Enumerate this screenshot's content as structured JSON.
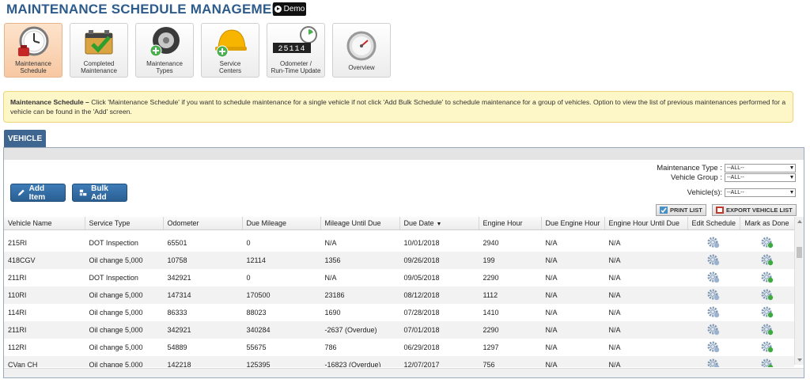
{
  "header": {
    "title": "MAINTENANCE SCHEDULE MANAGEMENT",
    "demo_label": "Demo"
  },
  "tiles": [
    {
      "label_line1": "Maintenance",
      "label_line2": "Schedule",
      "icon": "clock-icon"
    },
    {
      "label_line1": "Completed",
      "label_line2": "Maintenance",
      "icon": "battery-check-icon"
    },
    {
      "label_line1": "Maintenance",
      "label_line2": "Types",
      "icon": "tire-icon"
    },
    {
      "label_line1": "Service",
      "label_line2": "Centers",
      "icon": "hardhat-icon"
    },
    {
      "label_line1": "Odometer /",
      "label_line2": "Run-Time Update",
      "icon": "odometer-icon",
      "odometer_digits": "25114"
    },
    {
      "label_line1": "Overview",
      "label_line2": "",
      "icon": "gauge-icon"
    }
  ],
  "info": {
    "bold": "Maintenance Schedule –",
    "text": " Click 'Maintenance Schedule' if you want to schedule maintenance for a single vehicle if not click 'Add Bulk Schedule' to schedule maintenance for a group of vehicles. Option to view the list of previous maintenances performed for a vehicle can be found in the 'Add' screen."
  },
  "tab": {
    "label": "VEHICLE"
  },
  "filters": {
    "maintenance_type_label": "Maintenance Type :",
    "maintenance_type_value": "--ALL--",
    "vehicle_group_label": "Vehicle Group :",
    "vehicle_group_value": "--ALL--",
    "vehicles_label": "Vehicle(s):",
    "vehicles_value": "--ALL--"
  },
  "buttons": {
    "add_item": "Add Item",
    "bulk_add": "Bulk Add",
    "print_list": "PRINT LIST",
    "export_list": "EXPORT VEHICLE LIST"
  },
  "table": {
    "columns": [
      "Vehicle Name",
      "Service Type",
      "Odometer",
      "Due Mileage",
      "Mileage Until Due",
      "Due Date",
      "Engine Hour",
      "Due Engine Hour",
      "Engine Hour Until Due",
      "Edit Schedule",
      "Mark as Done"
    ],
    "sort_indicator": "▼",
    "rows": [
      [
        "215RI",
        "DOT Inspection",
        "65501",
        "0",
        "N/A",
        "10/01/2018",
        "2940",
        "N/A",
        "N/A"
      ],
      [
        "418CGV",
        "Oil change 5,000",
        "10758",
        "12114",
        "1356",
        "09/26/2018",
        "199",
        "N/A",
        "N/A"
      ],
      [
        "211RI",
        "DOT Inspection",
        "342921",
        "0",
        "N/A",
        "09/05/2018",
        "2290",
        "N/A",
        "N/A"
      ],
      [
        "110RI",
        "Oil change 5,000",
        "147314",
        "170500",
        "23186",
        "08/12/2018",
        "1112",
        "N/A",
        "N/A"
      ],
      [
        "114RI",
        "Oil change 5,000",
        "86333",
        "88023",
        "1690",
        "07/28/2018",
        "1410",
        "N/A",
        "N/A"
      ],
      [
        "211RI",
        "Oil change 5,000",
        "342921",
        "340284",
        "-2637 (Overdue)",
        "07/01/2018",
        "2290",
        "N/A",
        "N/A"
      ],
      [
        "112RI",
        "Oil change 5,000",
        "54889",
        "55675",
        "786",
        "06/29/2018",
        "1297",
        "N/A",
        "N/A"
      ],
      [
        "CVan CH",
        "Oil change 5,000",
        "142218",
        "125395",
        "-16823 (Overdue)",
        "12/07/2017",
        "756",
        "N/A",
        "N/A"
      ]
    ]
  }
}
